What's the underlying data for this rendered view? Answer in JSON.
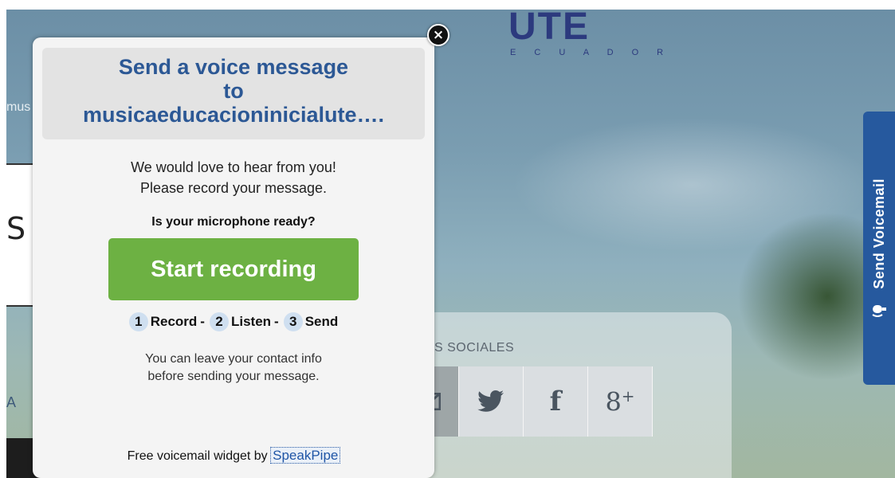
{
  "background": {
    "logo_text": "UTE",
    "logo_subtext": "E C U A D O R",
    "left_fragment": "mus",
    "panel_glyph": "S",
    "left_letter": "A",
    "social_title": "S SOCIALES",
    "social_icons": [
      "mail-icon",
      "twitter-icon",
      "facebook-icon",
      "google-plus-icon"
    ],
    "social_labels": {
      "facebook": "f",
      "google": "8",
      "google_sup": "+"
    }
  },
  "side_tab": {
    "label": "Send Voicemail",
    "icon": "microphone-icon",
    "color": "#26599e"
  },
  "modal": {
    "title_line1": "Send a voice message",
    "title_line2": "to",
    "title_line3": "musicaeducacioninicialute….",
    "intro_line1": "We would love to hear from you!",
    "intro_line2": "Please record your message.",
    "mic_question": "Is your microphone ready?",
    "start_button": "Start recording",
    "steps": [
      {
        "num": "1",
        "label": "Record"
      },
      {
        "num": "2",
        "label": "Listen"
      },
      {
        "num": "3",
        "label": "Send"
      }
    ],
    "step_separator": "-",
    "contact_line1": "You can leave your contact info",
    "contact_line2": "before sending your message.",
    "footer_text": "Free voicemail widget by",
    "footer_link": "SpeakPipe",
    "close_icon": "close-icon",
    "close_glyph": "×",
    "accent_color": "#6db143",
    "title_color": "#2c5895"
  }
}
